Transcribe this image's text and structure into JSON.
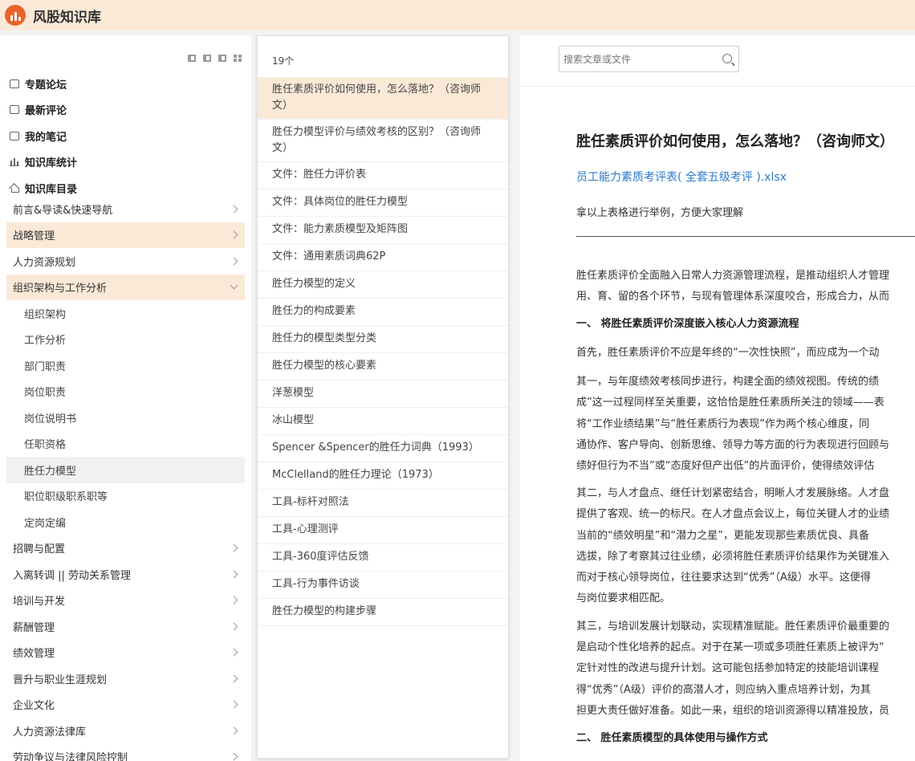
{
  "app": {
    "title": "风股知识库"
  },
  "sidebar": {
    "top_links": [
      {
        "label": "专题论坛",
        "icon": "forum-icon"
      },
      {
        "label": "最新评论",
        "icon": "comment-icon"
      },
      {
        "label": "我的笔记",
        "icon": "note-icon"
      },
      {
        "label": "知识库统计",
        "icon": "chart-icon"
      },
      {
        "label": "知识库目录",
        "icon": "home-icon"
      }
    ],
    "nav": [
      {
        "label": "前言&导读&快速导航",
        "level": 0
      },
      {
        "label": "战略管理",
        "level": 0,
        "active": true
      },
      {
        "label": "人力资源规划",
        "level": 0
      },
      {
        "label": "组织架构与工作分析",
        "level": 0,
        "active": true,
        "expanded": true
      },
      {
        "label": "组织架构",
        "level": 1
      },
      {
        "label": "工作分析",
        "level": 1
      },
      {
        "label": "部门职责",
        "level": 1
      },
      {
        "label": "岗位职责",
        "level": 1
      },
      {
        "label": "岗位说明书",
        "level": 1
      },
      {
        "label": "任职资格",
        "level": 1
      },
      {
        "label": "胜任力模型",
        "level": 1,
        "current": true
      },
      {
        "label": "职位职级职系职等",
        "level": 1
      },
      {
        "label": "定岗定编",
        "level": 1
      },
      {
        "label": "招聘与配置",
        "level": 0
      },
      {
        "label": "入离转调 || 劳动关系管理",
        "level": 0
      },
      {
        "label": "培训与开发",
        "level": 0
      },
      {
        "label": "薪酬管理",
        "level": 0
      },
      {
        "label": "绩效管理",
        "level": 0
      },
      {
        "label": "晋升与职业生涯规划",
        "level": 0
      },
      {
        "label": "企业文化",
        "level": 0
      },
      {
        "label": "人力资源法律库",
        "level": 0
      },
      {
        "label": "劳动争议与法律风险控制",
        "level": 0
      }
    ]
  },
  "list": {
    "count": "19个",
    "items": [
      {
        "title": "胜任素质评价如何使用，怎么落地？（咨询师\n文）",
        "selected": true
      },
      {
        "title": "胜任力模型评价与绩效考核的区别？（咨询师\n文）"
      },
      {
        "title": "文件：胜任力评价表"
      },
      {
        "title": "文件：具体岗位的胜任力模型"
      },
      {
        "title": "文件：能力素质模型及矩阵图"
      },
      {
        "title": "文件：通用素质词典62P"
      },
      {
        "title": "胜任力模型的定义"
      },
      {
        "title": "胜任力的构成要素"
      },
      {
        "title": "胜任力的模型类型分类"
      },
      {
        "title": "胜任力模型的核心要素"
      },
      {
        "title": "洋葱模型"
      },
      {
        "title": "冰山模型"
      },
      {
        "title": "Spencer &Spencer的胜任力词典（1993）"
      },
      {
        "title": "McClelland的胜任力理论（1973）"
      },
      {
        "title": "工具-标杆对照法"
      },
      {
        "title": "工具-心理测评"
      },
      {
        "title": "工具-360度评估反馈"
      },
      {
        "title": "工具-行为事件访谈"
      },
      {
        "title": "胜任力模型的构建步骤"
      }
    ]
  },
  "content": {
    "search_placeholder": "搜索文章或文件",
    "title": "胜任素质评价如何使用，怎么落地？（咨询师文）",
    "file_link": "员工能力素质考评表( 全套五级考评 ).xlsx",
    "intro": "拿以上表格进行举例，方便大家理解",
    "lines": [
      {
        "text": "胜任素质评价全面融入日常人力资源管理流程，是推动组织人才管理",
        "bold": false
      },
      {
        "text": "用、育、留的各个环节，与现有管理体系深度咬合，形成合力，从而",
        "bold": false
      },
      {
        "text": "一、  将胜任素质评价深度嵌入核心人力资源流程",
        "bold": true
      },
      {
        "text": "首先，胜任素质评价不应是年终的“一次性快照”，而应成为一个动",
        "bold": false
      },
      {
        "text": "其一，与年度绩效考核同步进行，构建全面的绩效视图。传统的绩",
        "bold": false
      },
      {
        "text": "成”这一过程同样至关重要，这恰恰是胜任素质所关注的领域——表",
        "bold": false
      },
      {
        "text": "将“工作业绩结果”与“胜任素质行为表现”作为两个核心维度，同",
        "bold": false
      },
      {
        "text": "通协作、客户导向、创新思维、领导力等方面的行为表现进行回顾与",
        "bold": false
      },
      {
        "text": "绩好但行为不当”或“态度好但产出低”的片面评价，使得绩效评估",
        "bold": false
      },
      {
        "text": "其二，与人才盘点、继任计划紧密结合，明晰人才发展脉络。人才盘",
        "bold": false
      },
      {
        "text": "提供了客观、统一的标尺。在人才盘点会议上，每位关键人才的业绩",
        "bold": false
      },
      {
        "text": "当前的“绩效明星”和“潜力之星”，更能发现那些素质优良、具备",
        "bold": false
      },
      {
        "text": "选拔，除了考察其过往业绩，必须将胜任素质评价结果作为关键准入",
        "bold": false
      },
      {
        "text": "而对于核心领导岗位，往往要求达到“优秀”（A级）水平。这便得",
        "bold": false
      },
      {
        "text": "与岗位要求相匹配。",
        "bold": false
      },
      {
        "text": "其三，与培训发展计划联动，实现精准赋能。胜任素质评价最重要的",
        "bold": false
      },
      {
        "text": "是启动个性化培养的起点。对于在某一项或多项胜任素质上被评为“",
        "bold": false
      },
      {
        "text": "定针对性的改进与提升计划。这可能包括参加特定的技能培训课程",
        "bold": false
      },
      {
        "text": "得“优秀”（A级）评价的高潜人才，则应纳入重点培养计划，为其",
        "bold": false
      },
      {
        "text": "担更大责任做好准备。如此一来，组织的培训资源得以精准投放，员",
        "bold": false
      },
      {
        "text": "二、  胜任素质模型的具体使用与操作方式",
        "bold": true
      }
    ]
  },
  "colors": {
    "accent": "#fbe9d8",
    "logo": "#e8632b",
    "link": "#2a7ac7"
  }
}
